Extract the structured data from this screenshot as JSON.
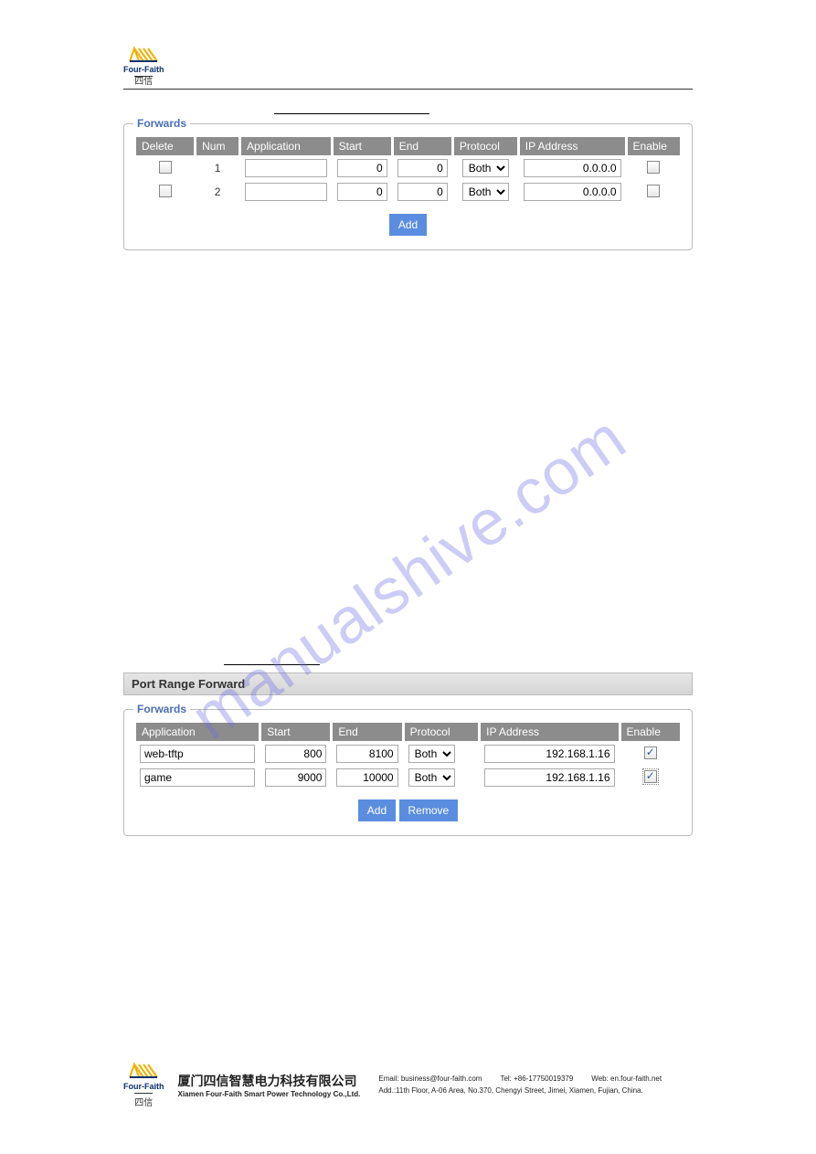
{
  "logo": {
    "brand": "Four-Faith",
    "sub": "四信"
  },
  "watermark": "manualshive.com",
  "forwards1": {
    "title": "Forwards",
    "headers": {
      "delete": "Delete",
      "num": "Num",
      "application": "Application",
      "start": "Start",
      "end": "End",
      "protocol": "Protocol",
      "ip": "IP Address",
      "enable": "Enable"
    },
    "rows": [
      {
        "num": "1",
        "application": "",
        "start": "0",
        "end": "0",
        "protocol": "Both",
        "ip": "0.0.0.0",
        "enable": false
      },
      {
        "num": "2",
        "application": "",
        "start": "0",
        "end": "0",
        "protocol": "Both",
        "ip": "0.0.0.0",
        "enable": false
      }
    ],
    "add_label": "Add"
  },
  "section2": {
    "bar_title": "Port Range Forward",
    "fieldset_title": "Forwards",
    "headers": {
      "application": "Application",
      "start": "Start",
      "end": "End",
      "protocol": "Protocol",
      "ip": "IP Address",
      "enable": "Enable"
    },
    "rows": [
      {
        "application": "web-tftp",
        "start": "800",
        "end": "8100",
        "protocol": "Both",
        "ip": "192.168.1.16",
        "enable": true
      },
      {
        "application": "game",
        "start": "9000",
        "end": "10000",
        "protocol": "Both",
        "ip": "192.168.1.16",
        "enable": true
      }
    ],
    "add_label": "Add",
    "remove_label": "Remove"
  },
  "footer": {
    "company_cn": "厦门四信智慧电力科技有限公司",
    "company_en": "Xiamen Four-Faith Smart Power Technology Co.,Ltd.",
    "email": "Email: business@four-faith.com",
    "tel": "Tel: +86-17750019379",
    "web": "Web: en.four-faith.net",
    "addr": "Add.:11th Floor, A-06 Area, No.370, Chengyi Street, Jimei, Xiamen, Fujian, China."
  }
}
